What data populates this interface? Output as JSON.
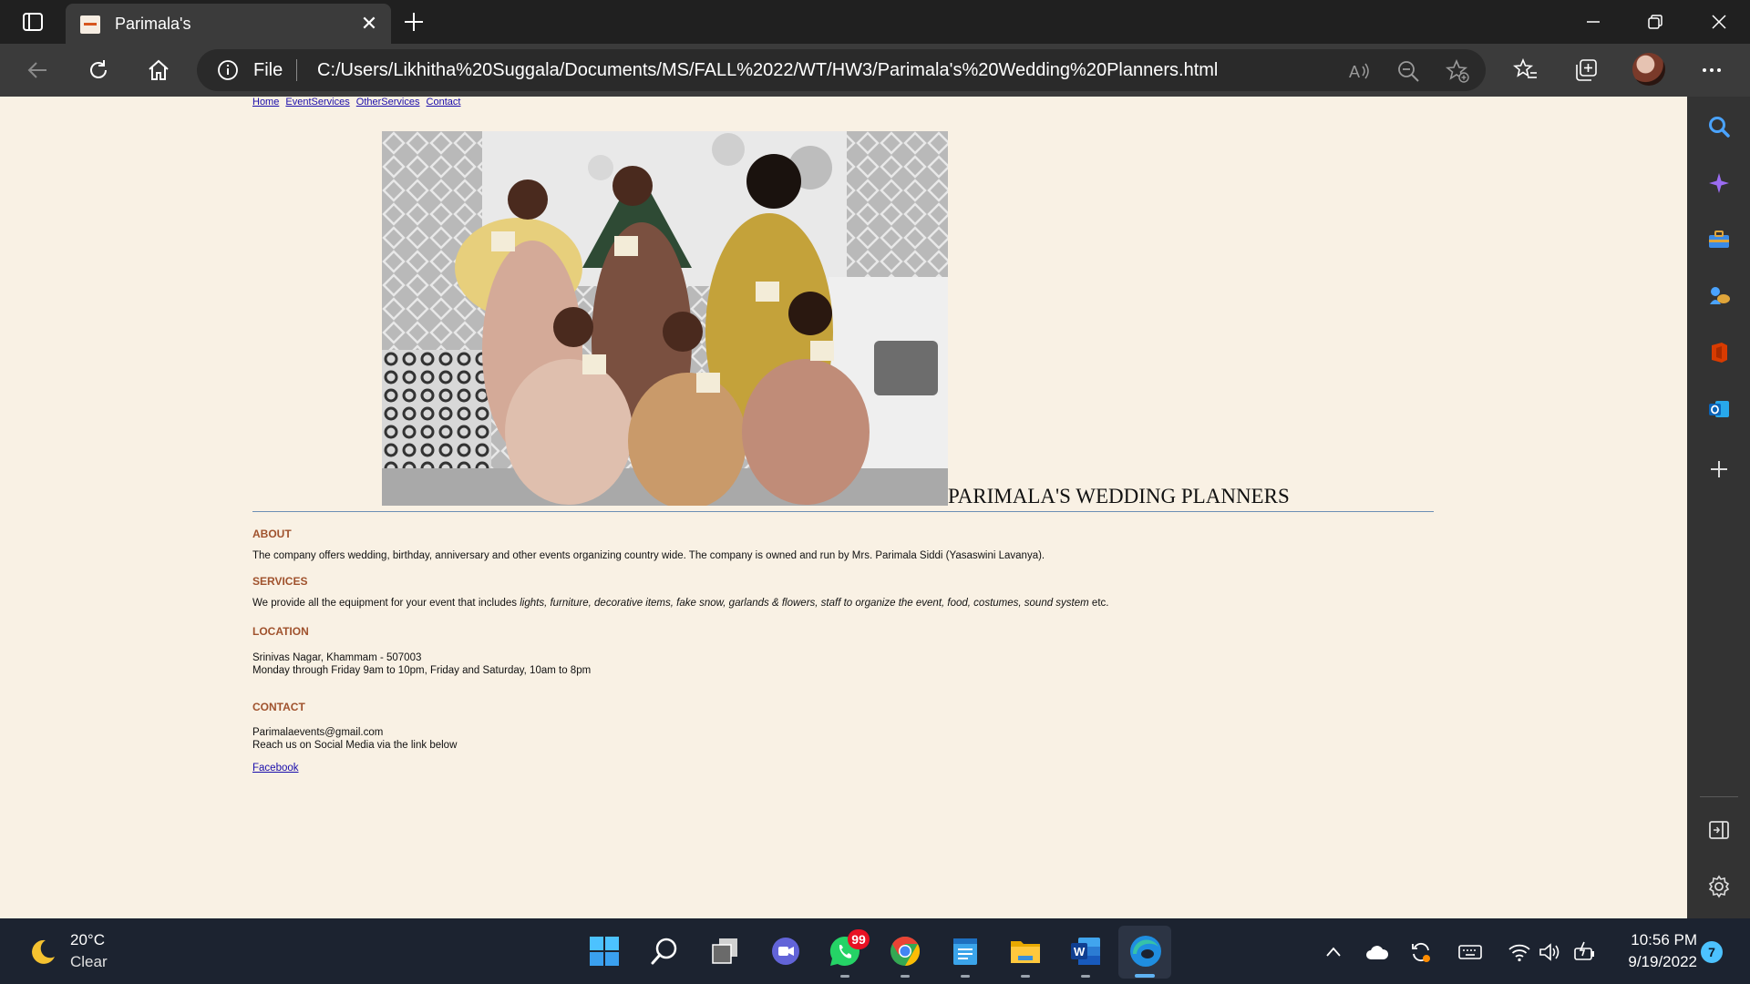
{
  "browser": {
    "tab": {
      "title": "Parimala's",
      "close_glyph": "✕"
    },
    "address": {
      "scheme_label": "File",
      "url": "C:/Users/Likhitha%20Suggala/Documents/MS/FALL%2022/WT/HW3/Parimala's%20Wedding%20Planners.html"
    }
  },
  "page": {
    "nav": [
      "Home",
      "EventServices",
      "OtherServices",
      "Contact"
    ],
    "site_title": "PARIMALA'S WEDDING PLANNERS",
    "about": {
      "heading": "ABOUT",
      "text": "The company offers wedding, birthday, anniversary and other events organizing country wide. The company is owned and run by Mrs. Parimala Siddi (Yasaswini Lavanya)."
    },
    "services": {
      "heading": "SERVICES",
      "text_prefix": "We provide all the equipment for your event that includes ",
      "text_italic": "lights, furniture, decorative items, fake snow, garlands & flowers, staff to organize the event, food, costumes, sound system",
      "text_suffix": " etc."
    },
    "location": {
      "heading": "LOCATION",
      "address": "Srinivas Nagar, Khammam - 507003",
      "hours": "Monday through Friday 9am to 10pm, Friday and Saturday, 10am to 8pm"
    },
    "contact": {
      "heading": "CONTACT",
      "email": "Parimalaevents@gmail.com",
      "social_text": "Reach us on Social Media via the link below",
      "link": "Facebook"
    }
  },
  "taskbar": {
    "weather": {
      "temp": "20°C",
      "desc": "Clear"
    },
    "whatsapp_badge": "99",
    "clock": {
      "time": "10:56 PM",
      "date": "9/19/2022"
    },
    "notifications": "7"
  },
  "colors": {
    "page_bg": "#f9f1e4",
    "heading": "#a0522d",
    "link": "#1a0dab",
    "divider": "#6c8fb5"
  }
}
